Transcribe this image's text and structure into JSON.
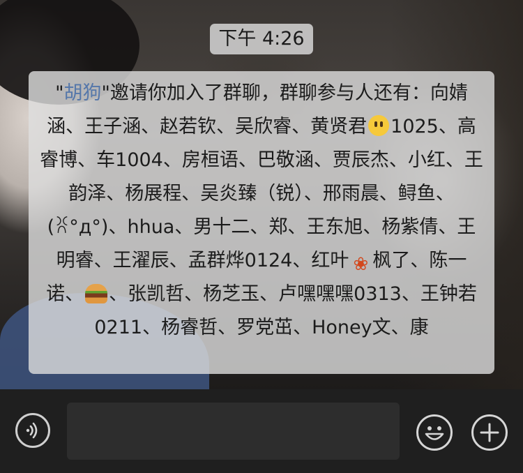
{
  "time_label": "下午 4:26",
  "notice": {
    "inviter": "胡狗",
    "intro": "邀请你加入了群聊，群聊参与人还有：",
    "segments": [
      "向婧涵、王子涵、赵若钦、吴欣睿、黄贤君",
      "1025、高睿博、车1004、房桓语、巴敬涵、贾辰杰、小红、王韵泽、杨展程、吴炎臻（锐）、邢雨晨、鲟鱼、(ꐦ°д°)、hhua、男十二、郑、王东旭、杨紫倩、王明睿、王濯辰、孟群烨0124、红叶",
      "枫了、陈一诺、",
      "、张凯哲、杨芝玉、卢嘿嘿嘿0313、王钟若0211、杨睿哲、罗党茁、Honey文、康"
    ]
  },
  "emojis": [
    "smile-emoji",
    "maple-leaf-emoji",
    "hamburger-emoji"
  ],
  "icons": {
    "voice": "voice-icon",
    "emoji": "emoji-face-icon",
    "plus": "plus-icon"
  },
  "colors": {
    "inviter_link": "#5577aa",
    "toolbar_bg": "#1f1f1f",
    "icon_stroke": "#d6d6d6"
  }
}
